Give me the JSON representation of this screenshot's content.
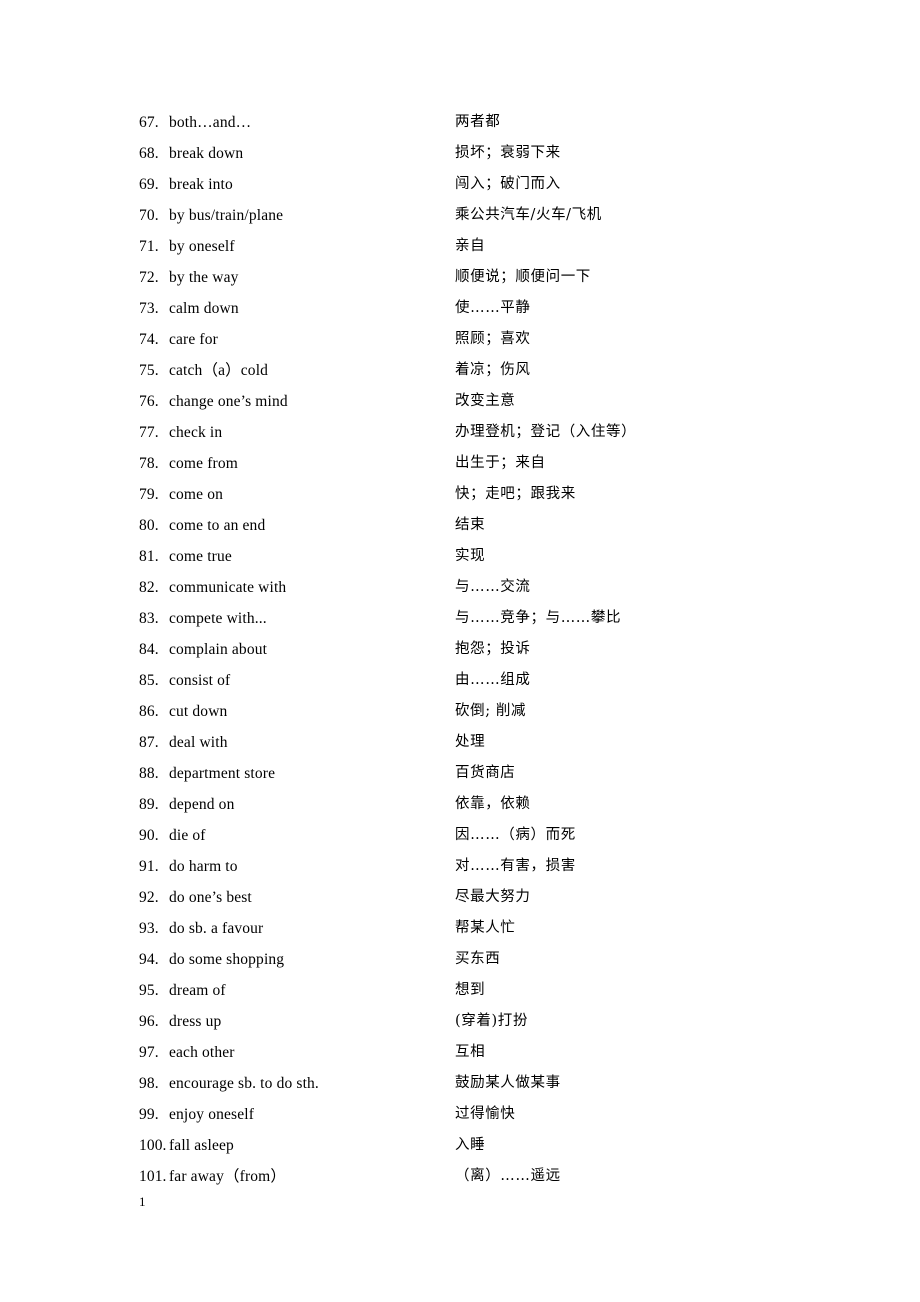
{
  "document": {
    "footer_page_number": "1",
    "background_color": "#ffffff",
    "text_color": "#000000"
  },
  "vocab_list": {
    "entries": [
      {
        "number": "67.",
        "english": "both…and…",
        "chinese": "两者都"
      },
      {
        "number": "68.",
        "english": "break down",
        "chinese": " 损坏；衰弱下来"
      },
      {
        "number": "69.",
        "english": "break into",
        "chinese": "闯入；破门而入"
      },
      {
        "number": "70.",
        "english": "by bus/train/plane",
        "chinese": "乘公共汽车/火车/飞机"
      },
      {
        "number": "71.",
        "english": "by oneself",
        "chinese": "亲自"
      },
      {
        "number": "72.",
        "english": "by the way",
        "chinese": "顺便说；顺便问一下"
      },
      {
        "number": "73.",
        "english": "calm down",
        "chinese": " 使……平静"
      },
      {
        "number": "74.",
        "english": "care for",
        "chinese": "照顾；喜欢"
      },
      {
        "number": "75.",
        "english": "catch（a）cold",
        "chinese": "着凉；伤风"
      },
      {
        "number": "76.",
        "english": "change one’s mind",
        "chinese": "改变主意"
      },
      {
        "number": "77.",
        "english": "check in",
        "chinese": "办理登机；登记（入住等）"
      },
      {
        "number": "78.",
        "english": "come from",
        "chinese": "出生于；来自"
      },
      {
        "number": "79.",
        "english": "come on",
        "chinese": "快；走吧；跟我来"
      },
      {
        "number": "80.",
        "english": "come to an end",
        "chinese": "结束"
      },
      {
        "number": "81.",
        "english": "come true",
        "chinese": "实现"
      },
      {
        "number": "82.",
        "english": "communicate with",
        "chinese": "与……交流"
      },
      {
        "number": "83.",
        "english": "compete with...",
        "chinese": "与……竞争；与……攀比"
      },
      {
        "number": "84.",
        "english": "complain about",
        "chinese": "抱怨；投诉"
      },
      {
        "number": "85.",
        "english": "consist of",
        "chinese": "由……组成"
      },
      {
        "number": "86.",
        "english": "cut down",
        "chinese": "砍倒; 削减"
      },
      {
        "number": "87.",
        "english": "deal with",
        "chinese": "处理"
      },
      {
        "number": "88.",
        "english": "department store",
        "chinese": "百货商店"
      },
      {
        "number": "89.",
        "english": "depend on",
        "chinese": "依靠，依赖"
      },
      {
        "number": "90.",
        "english": "die of",
        "chinese": "因……（病）而死"
      },
      {
        "number": "91.",
        "english": "do harm to",
        "chinese": "对……有害，损害"
      },
      {
        "number": "92.",
        "english": "do one’s best",
        "chinese": "尽最大努力"
      },
      {
        "number": "93.",
        "english": "do sb. a favour",
        "chinese": "帮某人忙"
      },
      {
        "number": "94.",
        "english": "do some shopping",
        "chinese": "买东西"
      },
      {
        "number": "95.",
        "english": "dream of",
        "chinese": "想到"
      },
      {
        "number": "96.",
        "english": "dress up",
        "chinese": "(穿着)打扮"
      },
      {
        "number": "97.",
        "english": "each other",
        "chinese": "互相"
      },
      {
        "number": "98.",
        "english": "encourage sb. to do sth.",
        "chinese": "鼓励某人做某事"
      },
      {
        "number": "99.",
        "english": "enjoy oneself",
        "chinese": "过得愉快"
      },
      {
        "number": "100.",
        "english": "fall asleep",
        "chinese": "入睡"
      },
      {
        "number": "101.",
        "english": "far away（from）",
        "chinese": " （离）……遥远"
      }
    ]
  }
}
